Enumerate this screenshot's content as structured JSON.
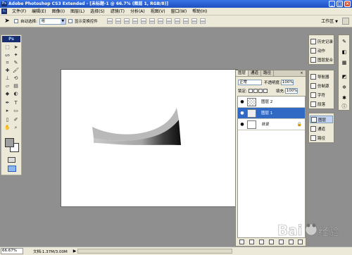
{
  "window": {
    "title": "Adobe Photoshop CS3 Extended - [未标题-1 @ 66.7% (图层 1, RGB/8)]",
    "min": "_",
    "max": "□",
    "close": "×"
  },
  "menu": [
    "文件(F)",
    "编辑(E)",
    "图像(I)",
    "图层(L)",
    "选择(S)",
    "滤镜(T)",
    "分析(A)",
    "视图(V)",
    "窗口(W)",
    "帮助(H)"
  ],
  "options": {
    "auto_select_label": "自动选择:",
    "auto_select_value": "组",
    "show_transform_label": "显示变换控件",
    "workspace_label": "工作区",
    "workspace_arrow": "▼"
  },
  "toolbox": {
    "ps_label": "Ps"
  },
  "canvas": {
    "shape_top_color": "#b9b9b9",
    "shape_bottom_dark": "#1a1a1a"
  },
  "status": {
    "zoom": "66.67%",
    "doc": "文档:1.37M/3.00M",
    "nav": "▶"
  },
  "layers_panel": {
    "tabs": [
      "图层",
      "通道",
      "路径"
    ],
    "close": "×",
    "blend_mode": "正常",
    "opacity_label": "不透明度:",
    "opacity_value": "100%",
    "lock_label": "锁定:",
    "fill_label": "填充:",
    "fill_value": "100%",
    "layers": [
      {
        "name": "图层 2",
        "selected": false,
        "lock": ""
      },
      {
        "name": "图层 1",
        "selected": true,
        "lock": ""
      },
      {
        "name": "背景",
        "selected": false,
        "lock": "🔒"
      }
    ],
    "eye": "●"
  },
  "dock_top": [
    "历史记录",
    "动作",
    "图层复合"
  ],
  "dock_mid": [
    "导航器",
    "仿制源",
    "字符",
    "段落"
  ],
  "dock_bottom": [
    "图层",
    "通道",
    "路径"
  ]
}
